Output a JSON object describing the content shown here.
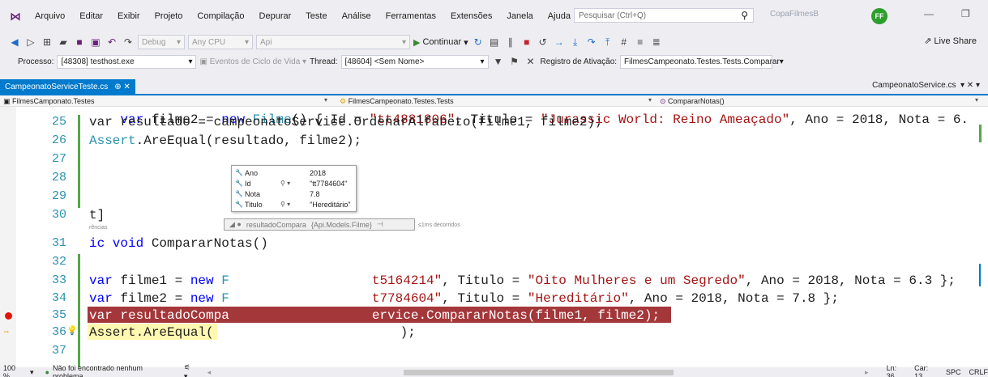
{
  "menu": {
    "items": [
      "Arquivo",
      "Editar",
      "Exibir",
      "Projeto",
      "Compilação",
      "Depurar",
      "Teste",
      "Análise",
      "Ferramentas",
      "Extensões",
      "Janela",
      "Ajuda"
    ],
    "search_placeholder": "Pesquisar (Ctrl+Q)",
    "solution_name": "CopaFilmesB",
    "avatar_initials": "FF"
  },
  "toolbar": {
    "config": "Debug",
    "platform": "Any CPU",
    "startup_project": "Api",
    "continue_label": "Continuar",
    "live_share": "Live Share"
  },
  "debug_bar": {
    "process_label": "Processo:",
    "process_value": "[48308] testhost.exe",
    "lifecycle_label": "Eventos de Ciclo de Vida",
    "thread_label": "Thread:",
    "thread_value": "[48604] <Sem Nome>",
    "stackframe_label": "Registro de Ativação:",
    "stackframe_value": "FilmesCampeonato.Testes.Tests.Comparar"
  },
  "tabs": {
    "active": "CampeonatoServiceTeste.cs",
    "active_suffix": "⊕ ✕",
    "right": "CampeonatoService.cs"
  },
  "navbar": {
    "project": "FilmesCamponato.Testes",
    "class": "FilmesCampeonato.Testes.Tests",
    "member": "CompararNotas()"
  },
  "editor": {
    "line_numbers": [
      "25",
      "26",
      "27",
      "28",
      "29",
      "30",
      "31",
      "32",
      "33",
      "34",
      "35",
      "36",
      "37"
    ],
    "codelens": "rências",
    "line_top": "var filme2 = new Filme() { Id = \"tt4881806\", Titulo = \"Jurassic World: Reino Ameaçado\", Ano = 2018, Nota = 6.",
    "line25_a": "var resultado = campeonatoService.OrdenarAlfabeto(filme1, filme2);",
    "line26_a": "Assert",
    "line26_b": ".AreEqual(resultado, filme2);",
    "line30": "t]",
    "line31_kw": "ic void",
    "line31_rest": " CompararNotas()",
    "line33_kw1": "var",
    "line33_mid": " filme1 = ",
    "line33_kw2": "new",
    "line33_f": " F",
    "line33_str1": "t5164214\"",
    "line33_b": ", Titulo = ",
    "line33_str2": "\"Oito Mulheres e um Segredo\"",
    "line33_c": ", Ano = 2018, Nota = 6.3 };",
    "line34_kw1": "var",
    "line34_mid": " filme2 = ",
    "line34_kw2": "new",
    "line34_f": " F",
    "line34_str1": "t7784604\"",
    "line34_b": ", Titulo = ",
    "line34_str2": "\"Hereditário\"",
    "line34_c": ", Ano = 2018, Nota = 7.8 };",
    "line35_a": "var resultadoCompa",
    "line35_b": "ervice.CompararNotas(filme1, filme2);",
    "line36_a": "Assert.AreEqual(",
    "line36_b": ");",
    "elapsed": "≤1ms decorridos"
  },
  "datatip": {
    "rows": [
      {
        "name": "Ano",
        "value": "2018",
        "has_search": false
      },
      {
        "name": "Id",
        "value": "\"tt7784604\"",
        "has_search": true
      },
      {
        "name": "Nota",
        "value": "7.8",
        "has_search": false
      },
      {
        "name": "Titulo",
        "value": "\"Hereditário\"",
        "has_search": true
      }
    ],
    "foot_name": "resultadoCompara",
    "foot_type": "{Api.Models.Filme}"
  },
  "statusbar": {
    "zoom": "100 %",
    "issues": "Não foi encontrado nenhum problema",
    "line": "Ln: 36",
    "col": "Car: 13",
    "ins": "SPC",
    "eol": "CRLF"
  },
  "colors": {
    "accent": "#007acc",
    "breakpoint_line": "#a4373a",
    "current_line": "#fff8b0"
  }
}
